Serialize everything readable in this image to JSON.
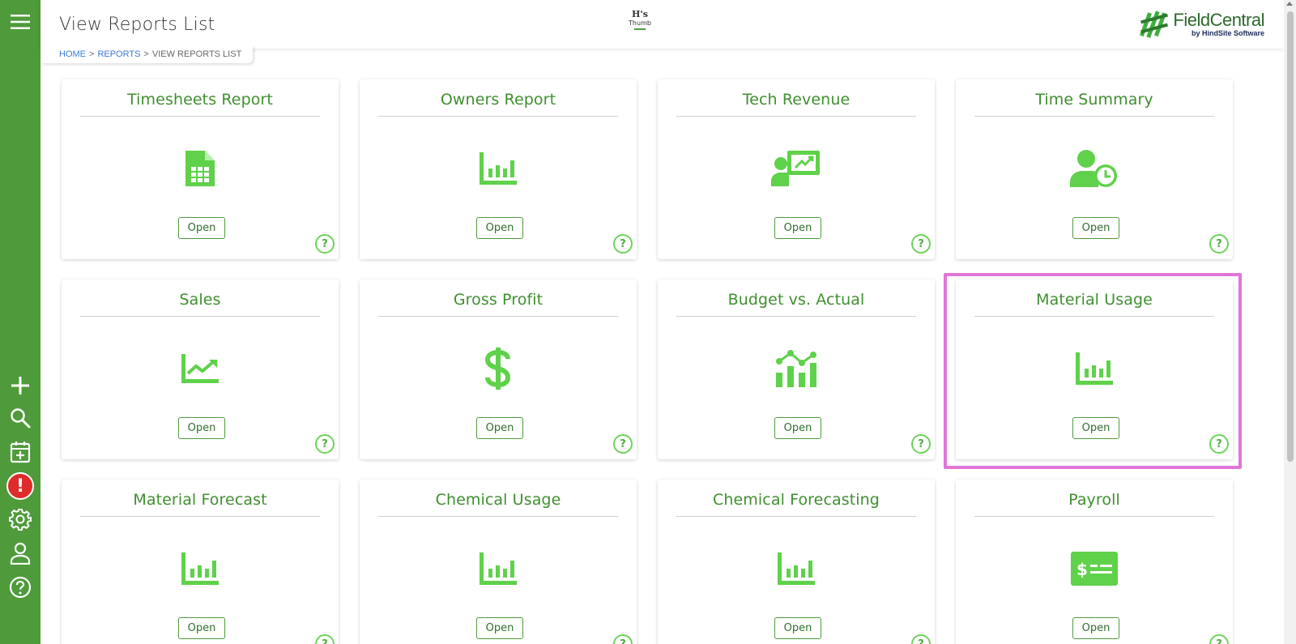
{
  "header": {
    "title": "View Reports List",
    "center_logo_line1": "H's",
    "center_logo_line2": "Thumb",
    "brand_name": "FieldCentral",
    "brand_sub": "by HindSite Software"
  },
  "breadcrumb": {
    "home": "HOME",
    "reports": "REPORTS",
    "current": "VIEW REPORTS LIST",
    "separator": ">"
  },
  "sidebar": {
    "top_icon": "menu-icon",
    "items": [
      "add-icon",
      "search-icon",
      "calendar-add-icon",
      "alert-icon",
      "gear-icon",
      "user-icon",
      "help-icon"
    ],
    "alert_symbol": "!"
  },
  "colors": {
    "sidebar": "#4f9a3b",
    "accent": "#3f8f2f",
    "icon": "#5fd14a",
    "highlight": "#e075d8",
    "alert": "#e02b2b"
  },
  "cards": [
    {
      "title": "Timesheets Report",
      "icon": "spreadsheet-icon",
      "button": "Open",
      "help": "?"
    },
    {
      "title": "Owners Report",
      "icon": "bar-chart-icon",
      "button": "Open",
      "help": "?"
    },
    {
      "title": "Tech Revenue",
      "icon": "presentation-icon",
      "button": "Open",
      "help": "?"
    },
    {
      "title": "Time Summary",
      "icon": "user-clock-icon",
      "button": "Open",
      "help": "?"
    },
    {
      "title": "Sales",
      "icon": "trend-chart-icon",
      "button": "Open",
      "help": "?"
    },
    {
      "title": "Gross Profit",
      "icon": "dollar-icon",
      "button": "Open",
      "help": "?"
    },
    {
      "title": "Budget vs. Actual",
      "icon": "bar-line-chart-icon",
      "button": "Open",
      "help": "?"
    },
    {
      "title": "Material Usage",
      "icon": "bar-chart-icon",
      "button": "Open",
      "help": "?"
    },
    {
      "title": "Material Forecast",
      "icon": "bar-chart-icon",
      "button": "Open",
      "help": "?"
    },
    {
      "title": "Chemical Usage",
      "icon": "bar-chart-icon",
      "button": "Open",
      "help": "?"
    },
    {
      "title": "Chemical Forecasting",
      "icon": "bar-chart-icon",
      "button": "Open",
      "help": "?"
    },
    {
      "title": "Payroll",
      "icon": "money-check-icon",
      "button": "Open",
      "help": "?"
    }
  ]
}
